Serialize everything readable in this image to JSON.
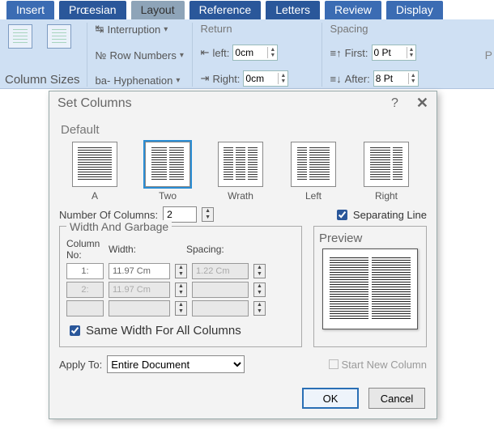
{
  "tabs": {
    "insert": "Insert",
    "design": "Prɶesian",
    "layout": "Layout",
    "reference": "Reference",
    "letters": "Letters",
    "review": "Review",
    "display": "Display"
  },
  "ribbon": {
    "colSizes": "Column Sizes",
    "interruption": "Interruption",
    "rowNumbers": "Row Numbers",
    "hyphenation": "Hyphenation",
    "returnLabel": "Return",
    "leftLabel": "left:",
    "leftVal": "0cm",
    "rightLabel": "Right:",
    "rightVal": "0cm",
    "spacingLabel": "Spacing",
    "firstLabel": "First:",
    "firstVal": "0 Pt",
    "afterLabel": "After:",
    "afterVal": "8 Pt",
    "strayP": "P"
  },
  "dialog": {
    "title": "Set Columns",
    "help": "?",
    "close": "✕",
    "defaultLabel": "Default",
    "presets": {
      "a": "A",
      "two": "Two",
      "wrath": "Wrath",
      "left": "Left",
      "right": "Right"
    },
    "numColsLabel": "Number Of Columns:",
    "numColsVal": "2",
    "sepLine": "Separating Line",
    "widthGroup": "Width And Garbage",
    "colNoHdr": "Column No:",
    "widthHdr": "Width:",
    "spacingHdr": "Spacing:",
    "rows": [
      {
        "idx": "1:",
        "w": "11.97 Cm",
        "s": "1.22 Cm"
      },
      {
        "idx": "2:",
        "w": "11.97 Cm",
        "s": ""
      },
      {
        "idx": "",
        "w": "",
        "s": ""
      }
    ],
    "sameWidth": "Same Width For All Columns",
    "previewLabel": "Preview",
    "applyToLabel": "Apply To:",
    "applyToVal": "Entire Document",
    "startNew": "Start New Column",
    "ok": "OK",
    "cancel": "Cancel"
  }
}
